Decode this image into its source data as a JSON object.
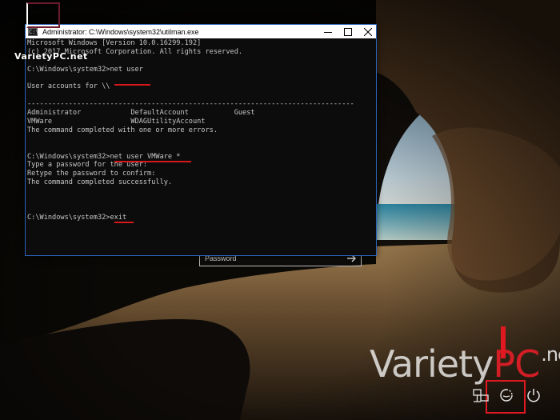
{
  "window": {
    "title": "Administrator: C:\\Windows\\system32\\utilman.exe",
    "icon_text": "C:\\",
    "controls": {
      "minimize": "minimize-icon",
      "maximize": "maximize-icon",
      "close": "close-icon"
    }
  },
  "console": {
    "lines": [
      "Microsoft Windows [Version 10.0.16299.192]",
      "(c) 2017 Microsoft Corporation. All rights reserved.",
      "",
      "C:\\Windows\\system32>net user",
      "",
      "User accounts for \\\\",
      "",
      "-------------------------------------------------------------------------------",
      "Administrator            DefaultAccount           Guest",
      "VMWare                   WDAGUtilityAccount",
      "The command completed with one or more errors.",
      "",
      "",
      "C:\\Windows\\system32>net user VMWare *",
      "Type a password for the user:",
      "Retype the password to confirm:",
      "The command completed successfully.",
      "",
      "",
      "",
      "C:\\Windows\\system32>exit"
    ]
  },
  "login": {
    "password_placeholder": "Password",
    "submit_icon": "arrow-right-icon"
  },
  "watermark": {
    "small": "VarietyPC.net",
    "big_prefix": "Variety",
    "big_pc": "PC",
    "big_suffix": ".net"
  },
  "system_icons": [
    "network-icon",
    "ease-of-access-icon",
    "power-icon"
  ],
  "colors": {
    "accent_red": "#e01820",
    "console_bg": "#0c0c0c",
    "console_text": "#c6c6c6",
    "window_border": "#2a63b8"
  }
}
